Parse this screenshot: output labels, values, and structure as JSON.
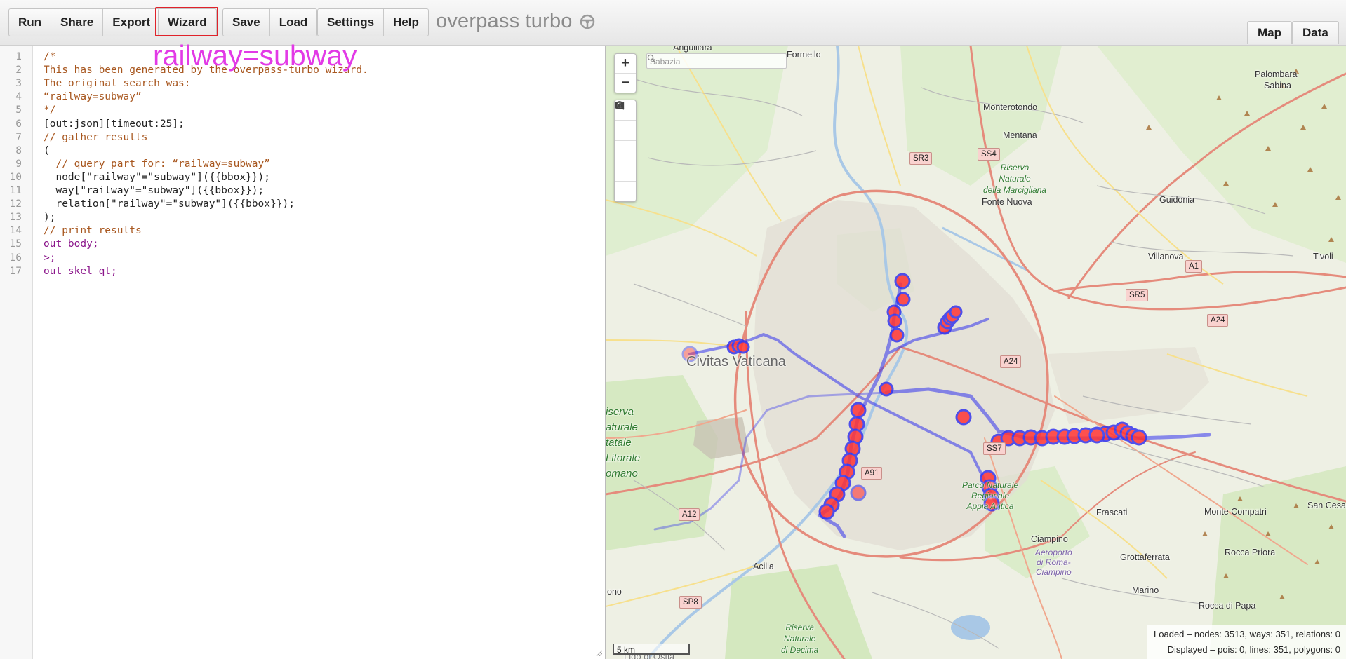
{
  "toolbar": {
    "group1": [
      "Run",
      "Share",
      "Export"
    ],
    "wizard": "Wizard",
    "group2": [
      "Save",
      "Load"
    ],
    "group3": [
      "Settings",
      "Help"
    ],
    "app_title": "overpass turbo",
    "title_icon": "steering-wheel-icon"
  },
  "annotation": "railway=subway",
  "tabs": {
    "map": "Map",
    "data": "Data"
  },
  "editor": {
    "line_numbers": [
      "1",
      "2",
      "3",
      "4",
      "5",
      "6",
      "7",
      "8",
      "9",
      "10",
      "11",
      "12",
      "13",
      "14",
      "15",
      "16",
      "17"
    ],
    "lines": [
      "/*",
      "This has been generated by the overpass-turbo wizard.",
      "The original search was:",
      "“railway=subway”",
      "*/",
      "[out:json][timeout:25];",
      "// gather results",
      "(",
      "  // query part for: “railway=subway”",
      "  node[\"railway\"=\"subway\"]({{bbox}});",
      "  way[\"railway\"=\"subway\"]({{bbox}});",
      "  relation[\"railway\"=\"subway\"]({{bbox}});",
      ");",
      "// print results",
      "out body;",
      ">;",
      "out skel qt;"
    ]
  },
  "map": {
    "zoom_in": "+",
    "zoom_out": "−",
    "tools": [
      "magnifier-icon",
      "circle-icon",
      "image-icon",
      "reset-icon",
      "cancel-icon"
    ],
    "search_placeholder": "Sabazia",
    "scale": "5 km",
    "scale_extra": "Lido di Ostia",
    "stats_loaded": "Loaded – nodes: 3513, ways: 351, relations: 0",
    "stats_displayed": "Displayed – pois: 0, lines: 351, polygons: 0",
    "labels": {
      "anguillara": "Anguillara",
      "formello": "Formello",
      "palombara": "Palombara",
      "sabina": "Sabina",
      "monterotondo": "Monterotondo",
      "mentana": "Mentana",
      "fonte_nuova": "Fonte Nuova",
      "guidonia": "Guidonia",
      "villanova": "Villanova",
      "tivoli": "Tivoli",
      "civitas": "Civitas Vaticana",
      "frascati": "Frascati",
      "monte_compatri": "Monte Compatri",
      "san_cesareo": "San Cesareo",
      "ciampino": "Ciampino",
      "grottaferrata": "Grottaferrata",
      "rocca_priora": "Rocca Priora",
      "acilia": "Acilia",
      "marino": "Marino",
      "rocca_di_papa": "Rocca di Papa",
      "ono": "ono",
      "riserva_marcigliana": "Riserva\nNaturale\ndella Marcigliana",
      "riserva_litorale": "iserva\naturale\ntatale\nLitorale\nomano",
      "parco_appia": "Parco Naturale\nRegionale\nAppia Antica",
      "riserva_decima": "Riserva\nNaturale\ndi Decima",
      "aeroporto": "Aeroporto\ndi Roma-\nCiampino"
    },
    "shields": [
      "SR3",
      "SS4",
      "A1",
      "SR5",
      "A24",
      "A24",
      "SS7",
      "A91",
      "A12",
      "SP8"
    ],
    "overlay_color": "#3333ee",
    "node_color": "#ff3333"
  }
}
